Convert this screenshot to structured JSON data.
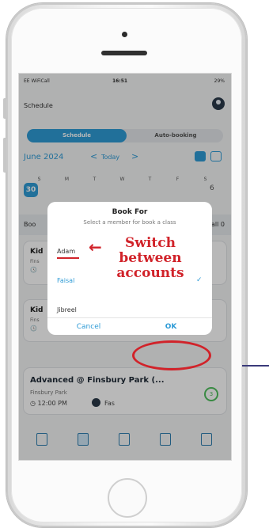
{
  "status_bar": {
    "carrier": "EE WiFiCall",
    "time": "16:51",
    "battery": "29%"
  },
  "header": {
    "title": "Schedule"
  },
  "tabs": [
    {
      "label": "Schedule",
      "selected": true
    },
    {
      "label": "Auto-booking",
      "selected": false
    }
  ],
  "calendar": {
    "month": "June 2024",
    "today_label": "Today",
    "weekdays": [
      "S",
      "M",
      "T",
      "W",
      "T",
      "F",
      "S"
    ],
    "selected_date": "30",
    "visible_last_date": "6"
  },
  "booking_bar": {
    "left": "Boo",
    "right": "all 0"
  },
  "cards": [
    {
      "title": "Kid",
      "sub": "Fins",
      "time": "🕓"
    },
    {
      "title": "Kid",
      "sub": "Fins",
      "time": "🕓"
    },
    {
      "title": "Advanced @ Finsbury Park (...",
      "location": "Finsbury Park",
      "time": "12:00 PM",
      "coach": "Fas",
      "count": "3"
    }
  ],
  "dialog": {
    "title": "Book For",
    "subtitle": "Select a member for book a class",
    "options": [
      "Adam",
      "Faisal",
      "Jibreel"
    ],
    "selected_option": "Faisal",
    "cancel_label": "Cancel",
    "ok_label": "OK"
  },
  "annotation": {
    "arrow": "←",
    "text": "Switch between accounts",
    "color": "#d1232a"
  },
  "colors": {
    "accent": "#2e9bd6",
    "annotation_red": "#d1232a",
    "count_green": "#4fbf5e"
  },
  "icons": {
    "check": "✓",
    "prev": "<",
    "next": ">"
  },
  "tabbar_icons": [
    "document-icon",
    "calendar-icon",
    "video-icon",
    "chart-icon",
    "monitor-icon"
  ]
}
